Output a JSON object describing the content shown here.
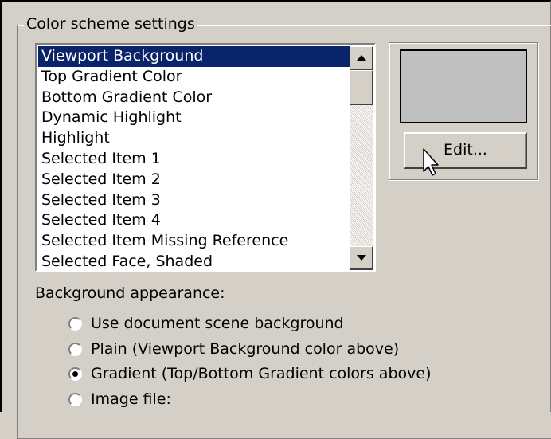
{
  "group": {
    "title": "Color scheme settings"
  },
  "list": {
    "items": [
      "Viewport Background",
      "Top Gradient Color",
      "Bottom Gradient Color",
      "Dynamic Highlight",
      "Highlight",
      "Selected Item 1",
      "Selected Item 2",
      "Selected Item 3",
      "Selected Item 4",
      "Selected Item Missing Reference",
      "Selected Face, Shaded"
    ],
    "selected_index": 0
  },
  "preview": {
    "swatch_color": "#c0c0c0",
    "edit_label": "Edit..."
  },
  "background": {
    "label": "Background appearance:",
    "options": [
      "Use document scene background",
      "Plain (Viewport Background color above)",
      "Gradient (Top/Bottom Gradient colors above)",
      "Image file:"
    ],
    "selected_index": 2
  },
  "colors": {
    "selection": "#0a246a",
    "face": "#d4d0c8"
  }
}
